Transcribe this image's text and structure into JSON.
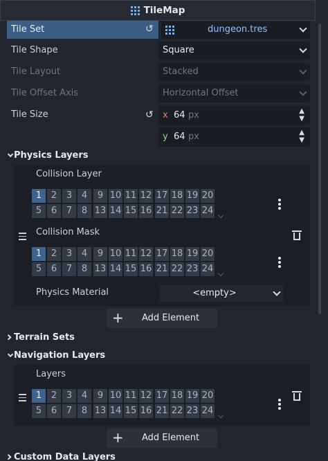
{
  "header": {
    "title": "TileMap",
    "icon": "tilemap-grid-icon"
  },
  "tileset": {
    "label": "Tile Set",
    "resource": "dungeon.tres",
    "reset_icon": "reset-icon",
    "resource_icon": "tileset-grid-icon"
  },
  "properties": [
    {
      "label": "Tile Shape",
      "value": "Square",
      "enabled": true
    },
    {
      "label": "Tile Layout",
      "value": "Stacked",
      "enabled": false
    },
    {
      "label": "Tile Offset Axis",
      "value": "Horizontal Offset",
      "enabled": false
    }
  ],
  "tile_size": {
    "label": "Tile Size",
    "x_label": "x",
    "x_value": "64",
    "y_label": "y",
    "y_value": "64",
    "unit": "px"
  },
  "sections": {
    "physics": "Physics Layers",
    "terrain": "Terrain Sets",
    "navigation": "Navigation Layers",
    "custom": "Custom Data Layers"
  },
  "physics_layer": {
    "collision_layer_label": "Collision Layer",
    "collision_mask_label": "Collision Mask",
    "material_label": "Physics Material",
    "material_value": "<empty>",
    "layer_selected": [
      1
    ],
    "mask_selected": [
      1
    ]
  },
  "navigation_layer": {
    "layers_label": "Layers",
    "selected": [
      1
    ]
  },
  "bit_rows": {
    "top": [
      "1",
      "2",
      "3",
      "4",
      "9",
      "10",
      "11",
      "12",
      "17",
      "18",
      "19",
      "20"
    ],
    "bottom": [
      "5",
      "6",
      "7",
      "8",
      "13",
      "14",
      "15",
      "16",
      "21",
      "22",
      "23",
      "24"
    ]
  },
  "add_element": "Add Element",
  "colors": {
    "accent": "#3b5e85",
    "selected_bit": "#3d6491",
    "resource_text": "#8cc3ff"
  }
}
